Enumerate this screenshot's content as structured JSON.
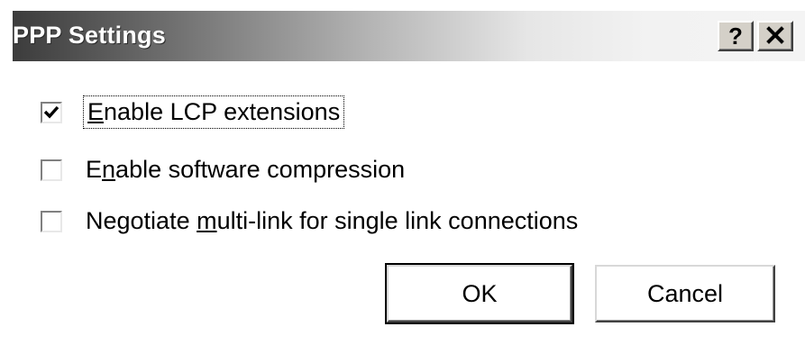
{
  "dialog": {
    "title": "PPP Settings",
    "help_button": "?",
    "close_button": "✕"
  },
  "options": [
    {
      "label_pre": "",
      "label_ul": "E",
      "label_post": "nable LCP extensions",
      "checked": true
    },
    {
      "label_pre": "E",
      "label_ul": "n",
      "label_post": "able software compression",
      "checked": false
    },
    {
      "label_pre": "Negotiate ",
      "label_ul": "m",
      "label_post": "ulti-link for single link connections",
      "checked": false
    }
  ],
  "buttons": {
    "ok_label": "OK",
    "cancel_label": "Cancel"
  },
  "icons": {
    "check": "checkmark-icon",
    "help": "question-mark-icon",
    "close": "close-icon"
  }
}
